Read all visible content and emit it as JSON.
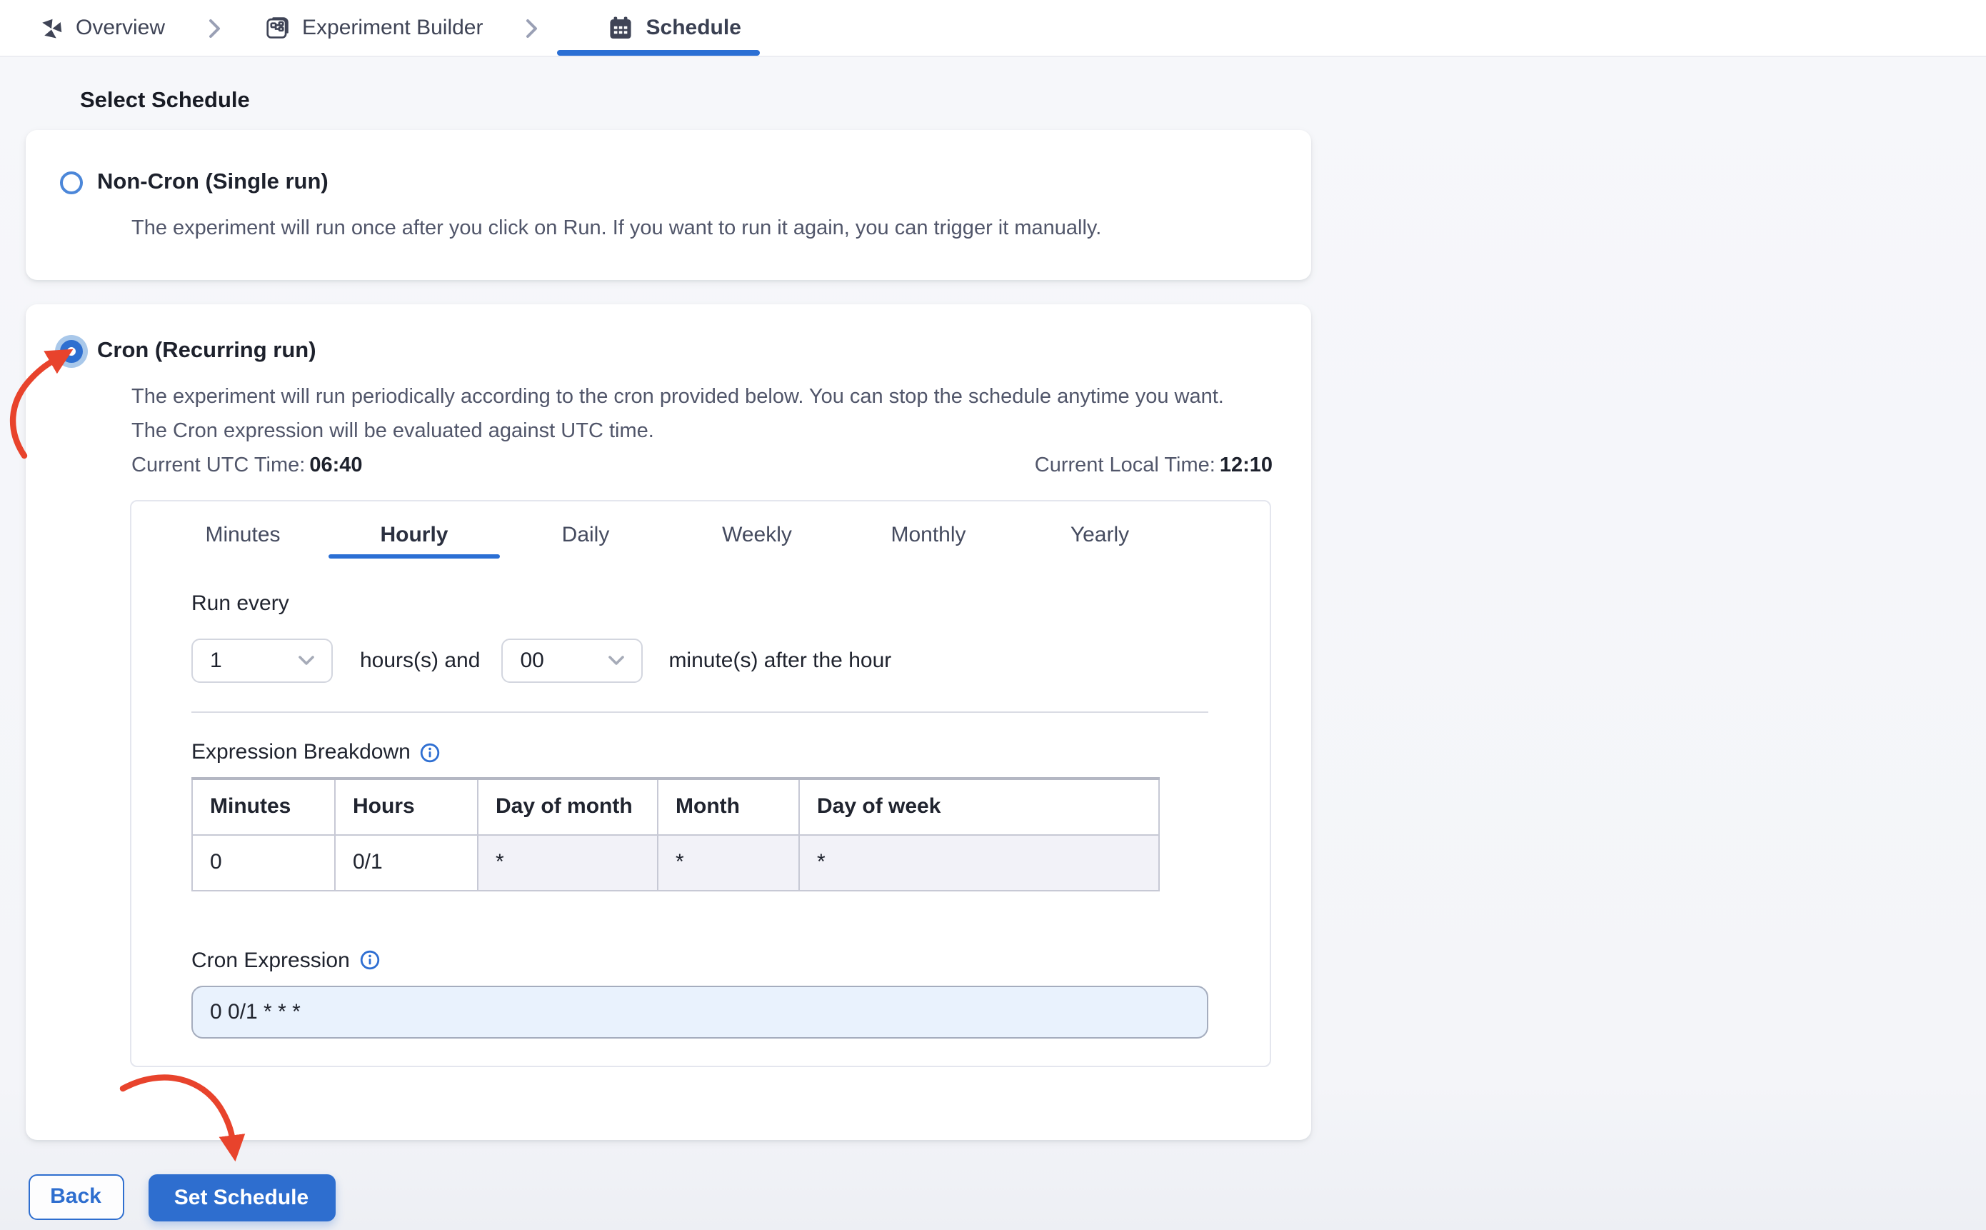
{
  "breadcrumb": {
    "items": [
      {
        "label": "Overview"
      },
      {
        "label": "Experiment Builder"
      },
      {
        "label": "Schedule"
      }
    ],
    "active": "Schedule"
  },
  "page": {
    "heading": "Select Schedule"
  },
  "schedule_options": {
    "non_cron": {
      "selected": false,
      "title": "Non-Cron (Single run)",
      "description": "The experiment will run once after you click on Run. If you want to run it again, you can trigger it manually."
    },
    "cron": {
      "selected": true,
      "title": "Cron (Recurring run)",
      "description_line1": "The experiment will run periodically according to the cron provided below. You can stop the schedule anytime you want.",
      "description_line2": "The Cron expression will be evaluated against UTC time.",
      "utc_label": "Current UTC Time:",
      "utc_value": "06:40",
      "local_label": "Current Local Time:",
      "local_value": "12:10"
    }
  },
  "cron_builder": {
    "tabs": [
      "Minutes",
      "Hourly",
      "Daily",
      "Weekly",
      "Monthly",
      "Yearly"
    ],
    "active_tab": "Hourly",
    "run_every_label": "Run every",
    "hours_value": "1",
    "hours_suffix": "hours(s) and",
    "minutes_value": "00",
    "minutes_suffix": "minute(s) after the hour",
    "breakdown": {
      "label": "Expression Breakdown",
      "headers": [
        "Minutes",
        "Hours",
        "Day of month",
        "Month",
        "Day of week"
      ],
      "values": [
        "0",
        "0/1",
        "*",
        "*",
        "*"
      ]
    },
    "expression": {
      "label": "Cron Expression",
      "value": "0 0/1 * * *"
    }
  },
  "footer": {
    "back_label": "Back",
    "submit_label": "Set Schedule"
  },
  "colors": {
    "accent": "#2e6ecf",
    "active_underline": "#2b6fd4",
    "arrow": "#e8432c",
    "input_bg": "#e9f2fd"
  }
}
